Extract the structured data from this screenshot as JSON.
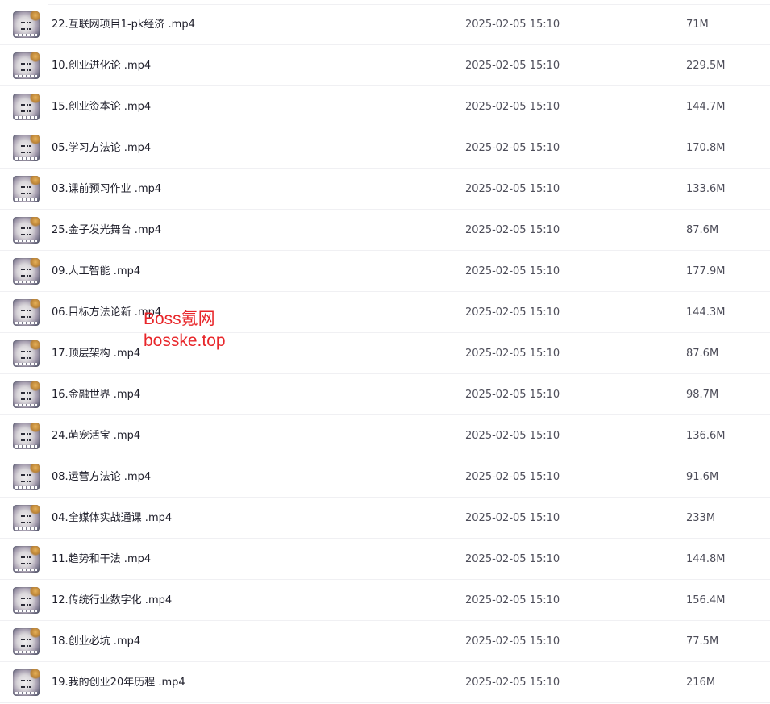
{
  "file_list": {
    "rows": [
      {
        "name": "22.互联网项目1-pk经济 .mp4",
        "date": "2025-02-05 15:10",
        "size": "71M"
      },
      {
        "name": "10.创业进化论 .mp4",
        "date": "2025-02-05 15:10",
        "size": "229.5M"
      },
      {
        "name": "15.创业资本论 .mp4",
        "date": "2025-02-05 15:10",
        "size": "144.7M"
      },
      {
        "name": "05.学习方法论 .mp4",
        "date": "2025-02-05 15:10",
        "size": "170.8M"
      },
      {
        "name": "03.课前预习作业 .mp4",
        "date": "2025-02-05 15:10",
        "size": "133.6M"
      },
      {
        "name": "25.金子发光舞台 .mp4",
        "date": "2025-02-05 15:10",
        "size": "87.6M"
      },
      {
        "name": "09.人工智能 .mp4",
        "date": "2025-02-05 15:10",
        "size": "177.9M"
      },
      {
        "name": "06.目标方法论新 .mp4",
        "date": "2025-02-05 15:10",
        "size": "144.3M"
      },
      {
        "name": "17.顶层架构 .mp4",
        "date": "2025-02-05 15:10",
        "size": "87.6M"
      },
      {
        "name": "16.金融世界 .mp4",
        "date": "2025-02-05 15:10",
        "size": "98.7M"
      },
      {
        "name": "24.萌宠活宝 .mp4",
        "date": "2025-02-05 15:10",
        "size": "136.6M"
      },
      {
        "name": "08.运营方法论 .mp4",
        "date": "2025-02-05 15:10",
        "size": "91.6M"
      },
      {
        "name": "04.全媒体实战通课 .mp4",
        "date": "2025-02-05 15:10",
        "size": "233M"
      },
      {
        "name": "11.趋势和干法 .mp4",
        "date": "2025-02-05 15:10",
        "size": "144.8M"
      },
      {
        "name": "12.传统行业数字化 .mp4",
        "date": "2025-02-05 15:10",
        "size": "156.4M"
      },
      {
        "name": "18.创业必坑 .mp4",
        "date": "2025-02-05 15:10",
        "size": "77.5M"
      },
      {
        "name": "19.我的创业20年历程 .mp4",
        "date": "2025-02-05 15:10",
        "size": "216M"
      }
    ]
  },
  "watermark": {
    "line1": "Boss氪网",
    "line2": "bosske.top",
    "color": "#e8262a"
  },
  "thumbnail_icon": "video-thumbnail-icon"
}
